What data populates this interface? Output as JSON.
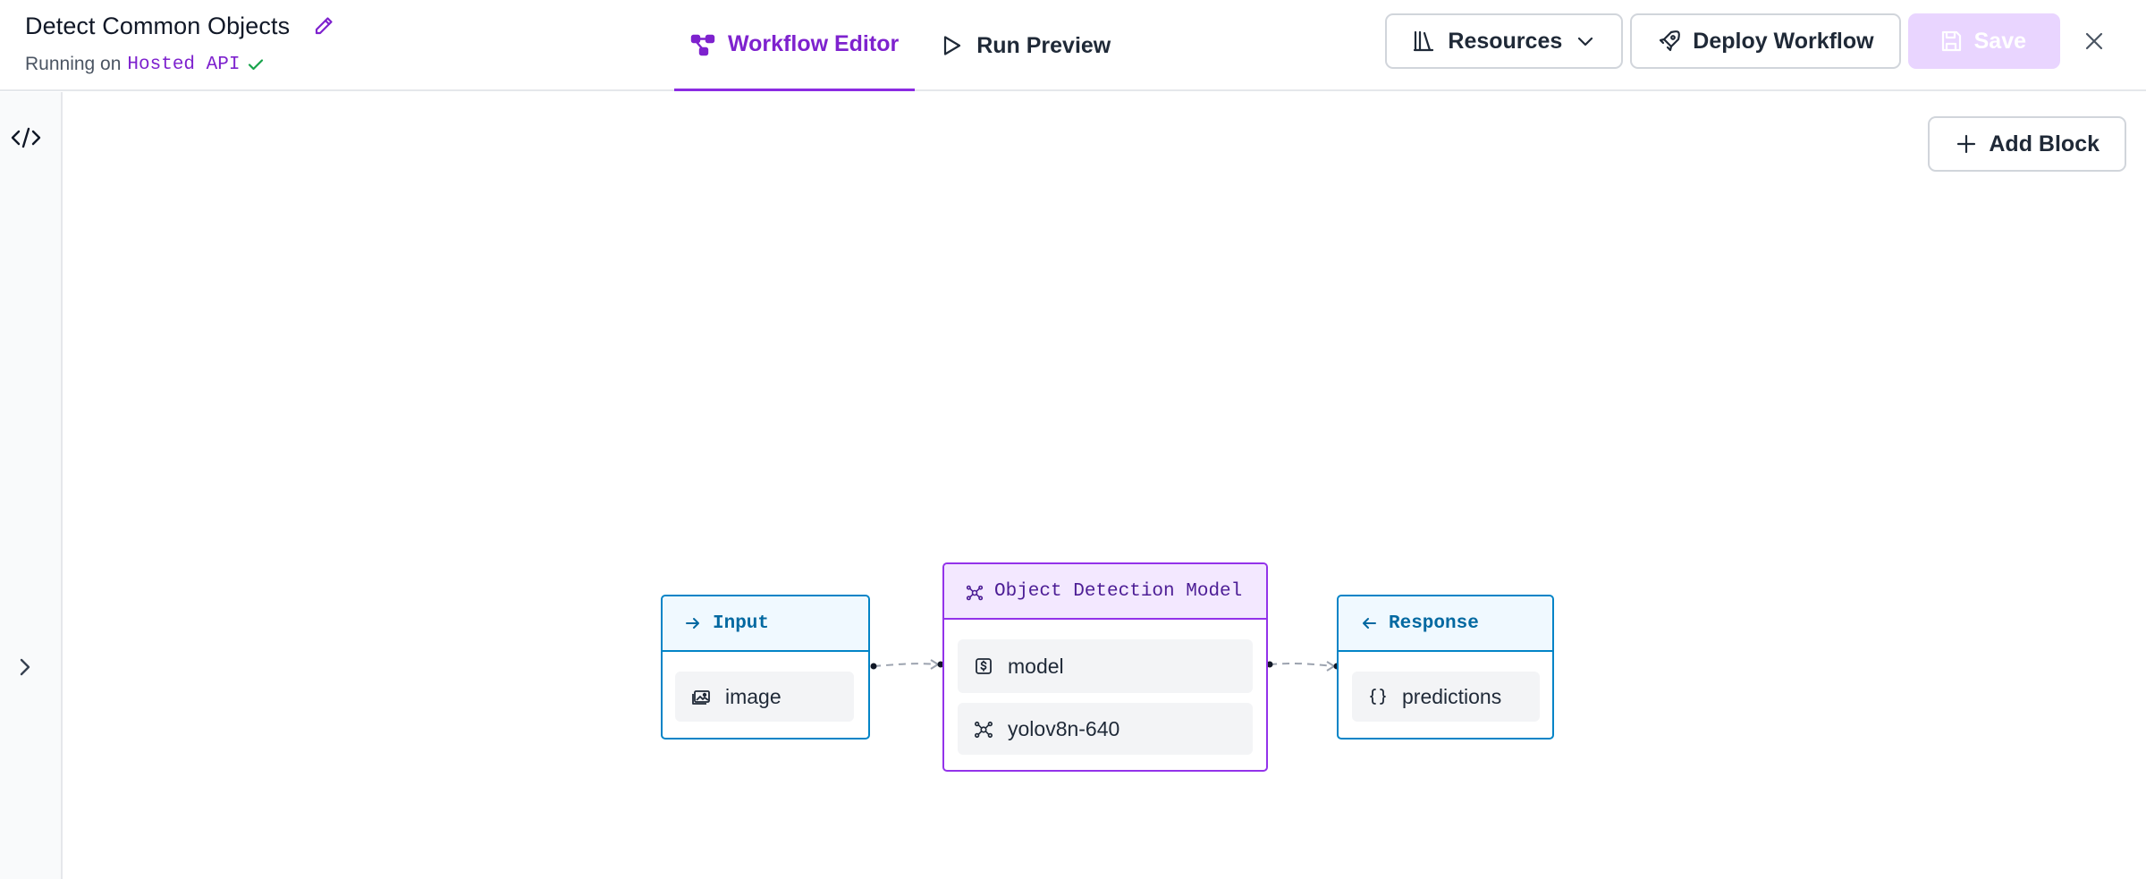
{
  "header": {
    "title": "Detect Common Objects",
    "running_prefix": "Running on",
    "host": "Hosted API",
    "tabs": [
      {
        "label": "Workflow Editor",
        "active": true,
        "icon": "workflow-icon"
      },
      {
        "label": "Run Preview",
        "active": false,
        "icon": "play-icon"
      }
    ],
    "actions": {
      "resources_label": "Resources",
      "deploy_label": "Deploy Workflow",
      "save_label": "Save"
    }
  },
  "canvas": {
    "add_block_label": "Add Block",
    "nodes": {
      "input": {
        "title": "Input",
        "chip": "image"
      },
      "model": {
        "title": "Object Detection Model",
        "chips": [
          "model",
          "yolov8n-640"
        ]
      },
      "response": {
        "title": "Response",
        "chip": "predictions"
      }
    }
  },
  "colors": {
    "accent": "#7e22ce",
    "io_border": "#0284c7",
    "model_border": "#9333ea",
    "save_disabled": "#e9d5ff",
    "success": "#16a34a"
  }
}
